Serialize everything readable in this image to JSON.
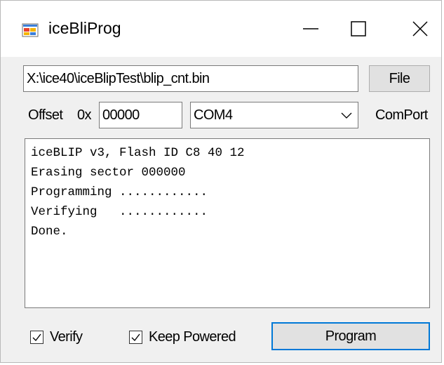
{
  "window": {
    "title": "iceBliProg",
    "icon": "app-icon",
    "controls": [
      "minimize-icon",
      "maximize-icon",
      "close-icon"
    ]
  },
  "file": {
    "path_value": "X:\\ice40\\iceBlipTest\\blip_cnt.bin",
    "button_label": "File"
  },
  "settings": {
    "offset_label": "Offset",
    "hex_prefix": "0x",
    "offset_value": "00000",
    "port_selected": "COM4",
    "port_label": "ComPort"
  },
  "output": {
    "text": "iceBLIP v3, Flash ID C8 40 12\nErasing sector 000000\nProgramming ............\nVerifying   ............\nDone."
  },
  "options": {
    "verify_label": "Verify",
    "verify_checked": true,
    "keep_powered_label": "Keep Powered",
    "keep_powered_checked": true
  },
  "actions": {
    "program_label": "Program"
  },
  "colors": {
    "window_bg": "#f0f0f0",
    "focus_border": "#0078d7",
    "button_bg": "#e1e1e1"
  }
}
